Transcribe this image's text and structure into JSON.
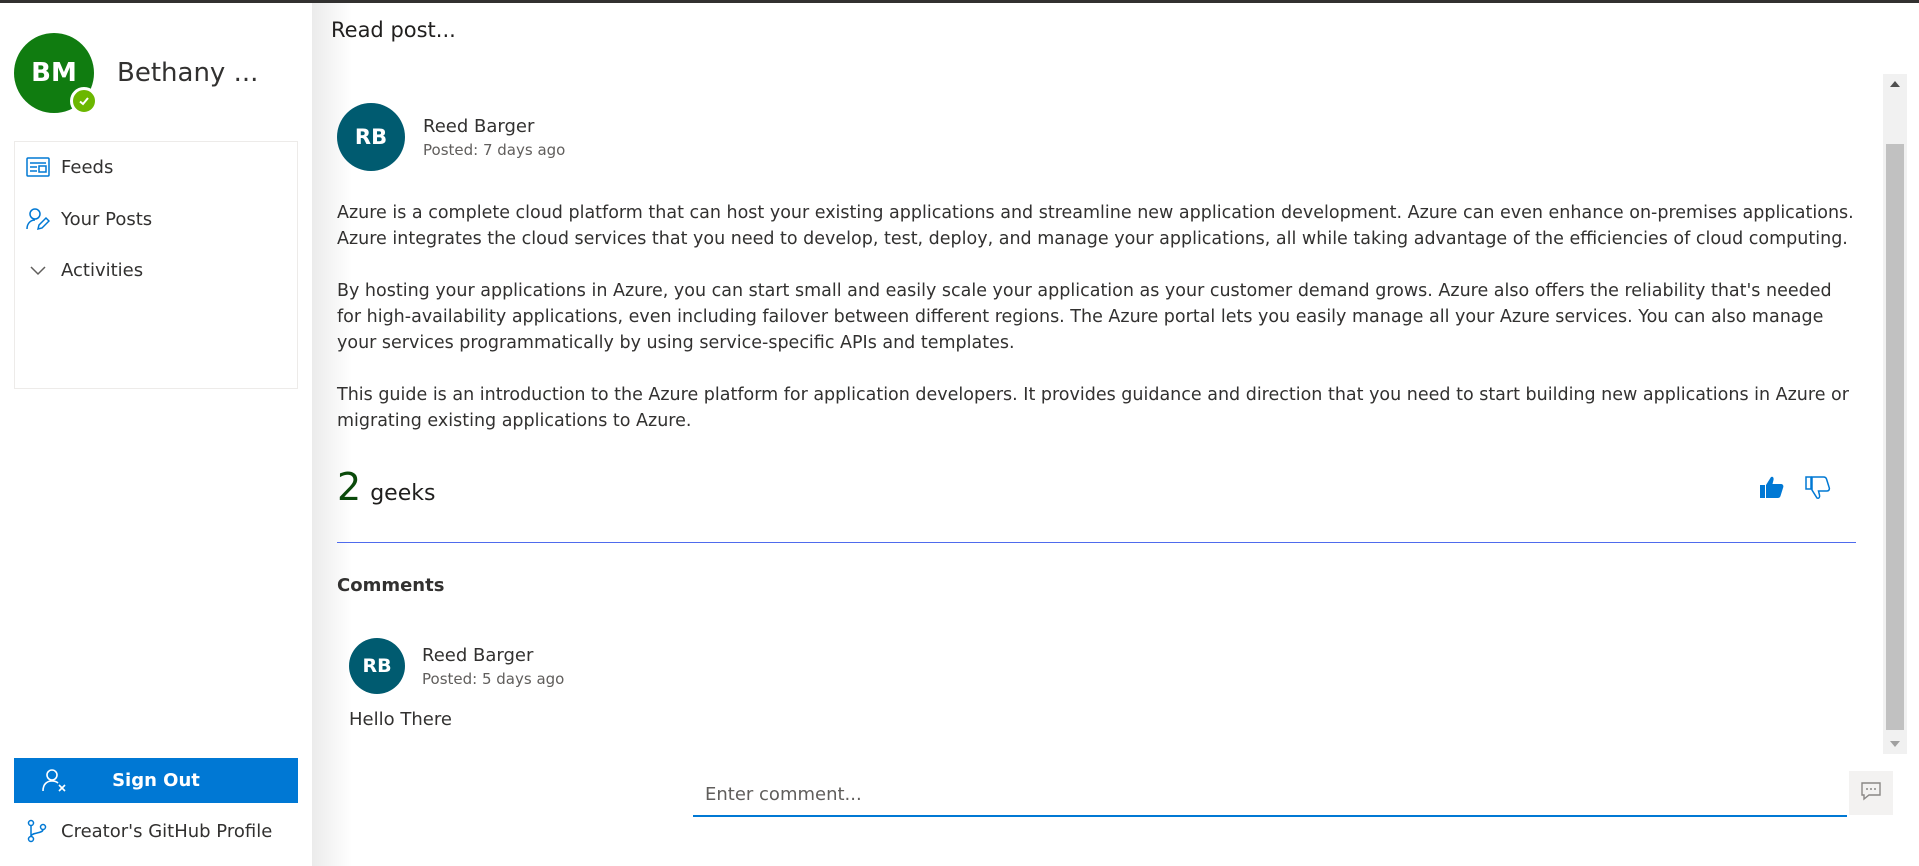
{
  "sidebar": {
    "profile": {
      "initials": "BM",
      "name": "Bethany ...",
      "avatar_color": "#107c10",
      "presence_color": "#6bb700"
    },
    "nav": [
      {
        "label": "Feeds",
        "icon": "feeds-icon"
      },
      {
        "label": "Your Posts",
        "icon": "edit-person-icon"
      },
      {
        "label": "Activities",
        "icon": "chevron-down-icon"
      }
    ],
    "signout_label": "Sign Out",
    "github_label": "Creator's GitHub Profile"
  },
  "main": {
    "title": "Read post...",
    "post": {
      "author_initials": "RB",
      "author_name": "Reed Barger",
      "posted": "Posted: 7 days ago",
      "paragraphs": [
        "Azure is a complete cloud platform that can host your existing applications and streamline new application development. Azure can even enhance on-premises applications. Azure integrates the cloud services that you need to develop, test, deploy, and manage your applications, all while taking advantage of the efficiencies of cloud computing.",
        "By hosting your applications in Azure, you can start small and easily scale your application as your customer demand grows. Azure also offers the reliability that's needed for high-availability applications, even including failover between different regions. The Azure portal lets you easily manage all your Azure services. You can also manage your services programmatically by using service-specific APIs and templates.",
        "This guide is an introduction to the Azure platform for application developers. It provides guidance and direction that you need to start building new applications in Azure or migrating existing applications to Azure."
      ],
      "likes_count": "2",
      "likes_label": "geeks"
    },
    "comments": {
      "title": "Comments",
      "items": [
        {
          "author_initials": "RB",
          "author_name": "Reed Barger",
          "posted": "Posted: 5 days ago",
          "text": "Hello There"
        }
      ],
      "input_placeholder": "Enter comment..."
    }
  },
  "colors": {
    "accent": "#0078d4",
    "avatar_teal": "#005b70",
    "likes": "#0b4a0b",
    "divider": "#4f6bed"
  }
}
